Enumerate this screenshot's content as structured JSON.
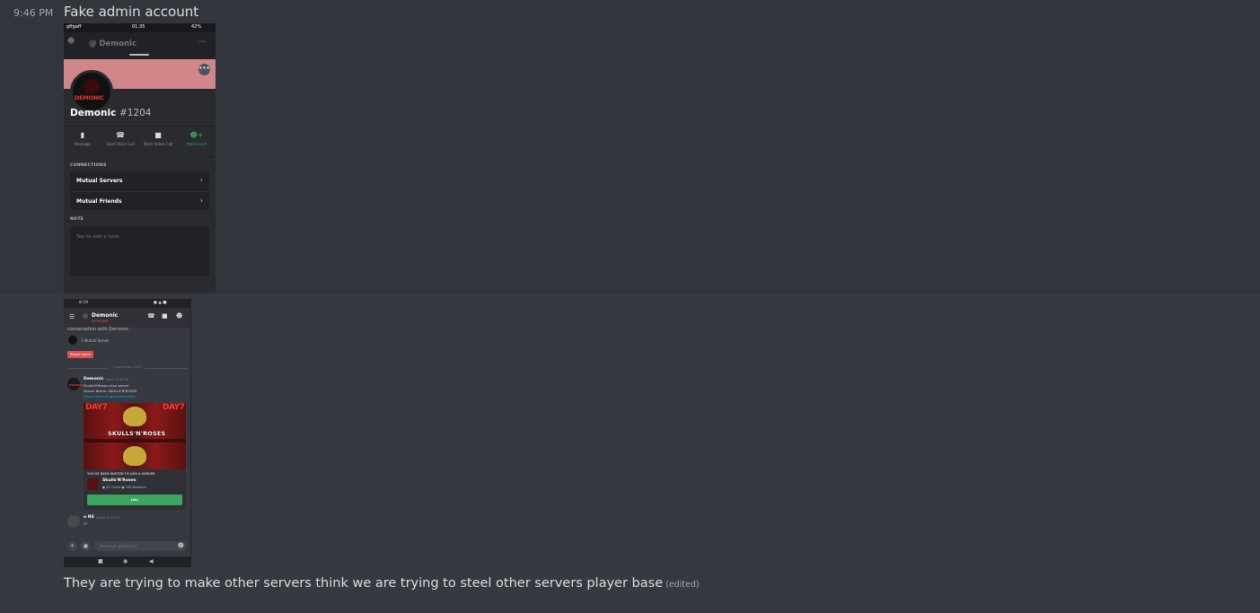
{
  "message": {
    "timestamp": "9:46 PM",
    "text": "Fake admin account",
    "followup_text": "They are trying to make other servers think we are trying to steel other servers player base",
    "edited_label": "(edited)"
  },
  "shot1": {
    "status": {
      "carrier": "gffgaff",
      "time": "01:35",
      "battery": "42%"
    },
    "header": {
      "channel": "Demonic",
      "more": "···"
    },
    "avatar_text": "DEMONIC",
    "username": "Demonic",
    "discriminator": "#1204",
    "actions": [
      "Message",
      "Start Voice Call",
      "Start Video Call",
      "Add Friend"
    ],
    "connections_label": "CONNECTIONS",
    "list": [
      "Mutual Servers",
      "Mutual Friends"
    ],
    "note_label": "NOTE",
    "note_placeholder": "Tap to add a note"
  },
  "shot2": {
    "status": {
      "time": "8:19"
    },
    "header": {
      "name": "Demonic",
      "sub": "WORKING"
    },
    "intro": "conversation with Demonic.",
    "mutual": "1 Mutual Server",
    "report": "Report Spam",
    "date_divider": "7 September 2022",
    "author": "Demonic",
    "time": "Today at 00:08",
    "lines": [
      "Skulls'N'Roses vkxx server",
      "Server Name: SKULLS'N'ROSES",
      "https://discord.gg/skullsnroses"
    ],
    "banner_day": "DAY7",
    "banner_title": "SKULLS'N'ROSES",
    "invite_header": "YOU'VE BEEN INVITED TO JOIN A SERVER",
    "invite_name": "Skulls'N'Roses",
    "invite_stats": "● 50 Online  ● 306 Members",
    "join": "Join",
    "author2": "o NS",
    "time2": "Today at 00:09",
    "text2": "??",
    "input_placeholder": "Message @Demonic"
  }
}
